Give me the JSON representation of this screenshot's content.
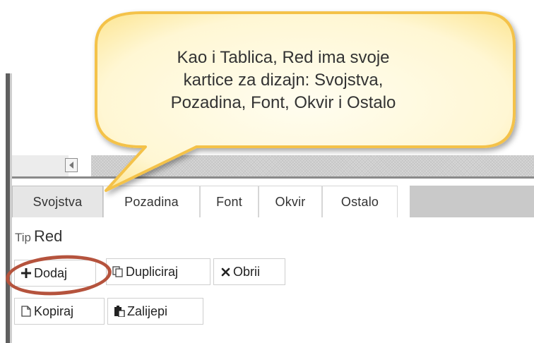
{
  "callout": {
    "lines": [
      "Kao i Tablica, Red ima svoje",
      "kartice za dizajn: Svojstva,",
      "Pozadina, Font, Okvir i Ostalo"
    ]
  },
  "tabs": [
    {
      "label": "Svojstva",
      "active": true
    },
    {
      "label": "Pozadina",
      "active": false
    },
    {
      "label": "Font",
      "active": false
    },
    {
      "label": "Okvir",
      "active": false
    },
    {
      "label": "Ostalo",
      "active": false
    }
  ],
  "properties": {
    "type_label": "Tip",
    "type_value": "Red"
  },
  "buttons": {
    "add": {
      "label": "Dodaj",
      "icon": "plus-icon"
    },
    "duplicate": {
      "label": "Dupliciraj",
      "icon": "duplicate-icon"
    },
    "delete": {
      "label": "Obrii",
      "icon": "close-icon"
    },
    "copy": {
      "label": "Kopiraj",
      "icon": "copy-icon"
    },
    "paste": {
      "label": "Zalijepi",
      "icon": "paste-icon"
    }
  },
  "colors": {
    "highlight_circle": "#b5533d",
    "bubble_fill": "#fff9d8",
    "bubble_border": "#f5c344"
  }
}
